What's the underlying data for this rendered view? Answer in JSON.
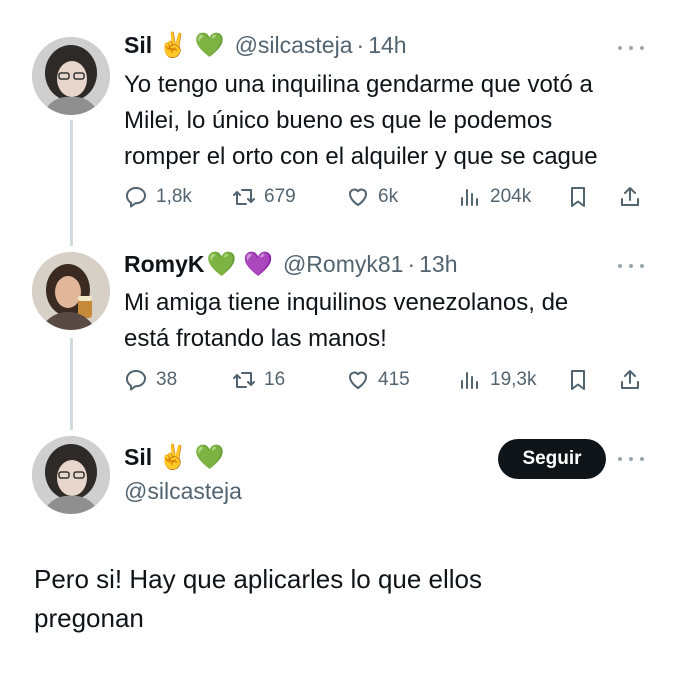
{
  "tweets": [
    {
      "name": "Sil",
      "emojis": "✌️ 💚",
      "handle": "@silcasteja",
      "time": "14h",
      "text_lines": [
        "Yo tengo una inquilina gendarme que votó a",
        "Milei, lo único bueno es que le podemos",
        "romper el orto con el alquiler y que se cague"
      ],
      "replies": "1,8k",
      "retweets": "679",
      "likes": "6k",
      "views": "204k"
    },
    {
      "name": "RomyK",
      "emojis": "💚 💜",
      "handle": "@Romyk81",
      "time": "13h",
      "text_lines": [
        "Mi amiga tiene inquilinos venezolanos, de",
        "está frotando las manos!"
      ],
      "replies": "38",
      "retweets": "16",
      "likes": "415",
      "views": "19,3k"
    }
  ],
  "main": {
    "name": "Sil",
    "emojis": "✌️ 💚",
    "handle": "@silcasteja",
    "follow_label": "Seguir",
    "text_lines": [
      "Pero si! Hay que aplicarles lo que ellos",
      "pregonan"
    ]
  },
  "separator": "·",
  "icons": {
    "reply": "reply-icon",
    "retweet": "retweet-icon",
    "like": "heart-icon",
    "views": "views-icon",
    "bookmark": "bookmark-icon",
    "share": "share-icon",
    "more": "more-icon"
  },
  "colors": {
    "text": "#0f1419",
    "secondary": "#536471",
    "thread_line": "#cfd9de",
    "follow_bg": "#0f1419"
  }
}
